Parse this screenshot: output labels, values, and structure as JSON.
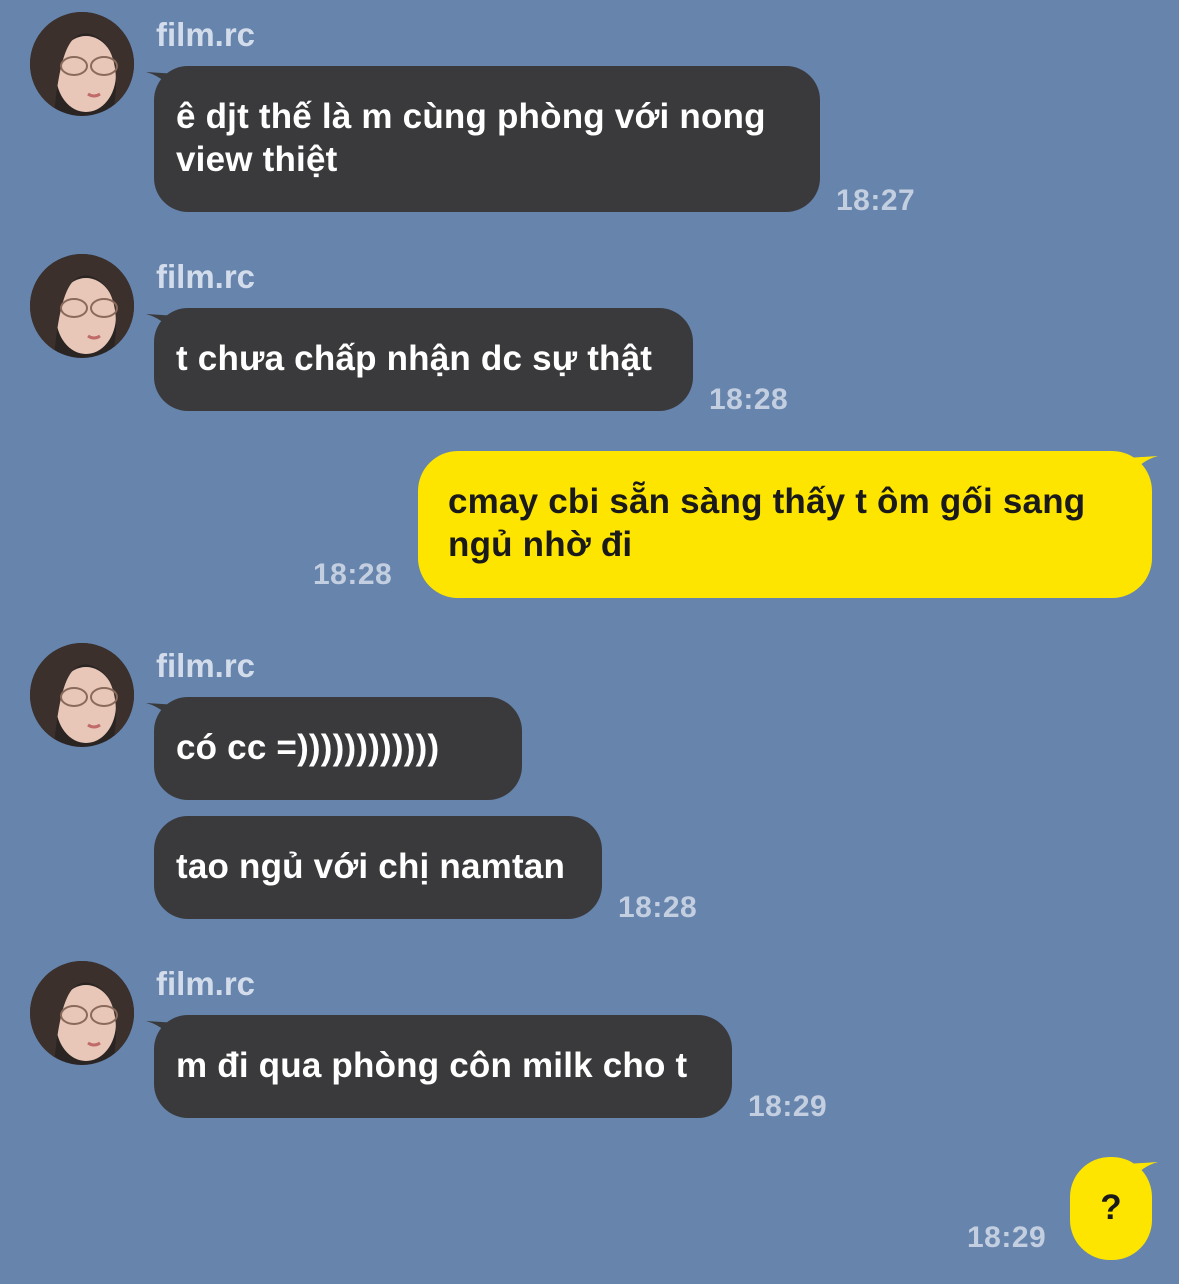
{
  "contact": {
    "name": "film.rc",
    "avatar": "avatar-photo"
  },
  "messages": [
    {
      "text": "ê djt thế là m cùng phòng với nong view thiệt",
      "time": "18:27"
    },
    {
      "text": "t chưa chấp nhận dc sự thật",
      "time": "18:28"
    },
    {
      "text": "cmay cbi sẵn sàng thấy t ôm gối sang ngủ nhờ đi",
      "time": "18:28"
    },
    {
      "text": "có cc =))))))))))))"
    },
    {
      "text": "tao ngủ với chị namtan",
      "time": "18:28"
    },
    {
      "text": "m đi qua phòng côn milk cho t",
      "time": "18:29"
    },
    {
      "text": "?",
      "time": "18:29"
    }
  ],
  "colors": {
    "background": "#6684ac",
    "incoming": "#3a3a3c",
    "outgoing": "#fee500"
  }
}
